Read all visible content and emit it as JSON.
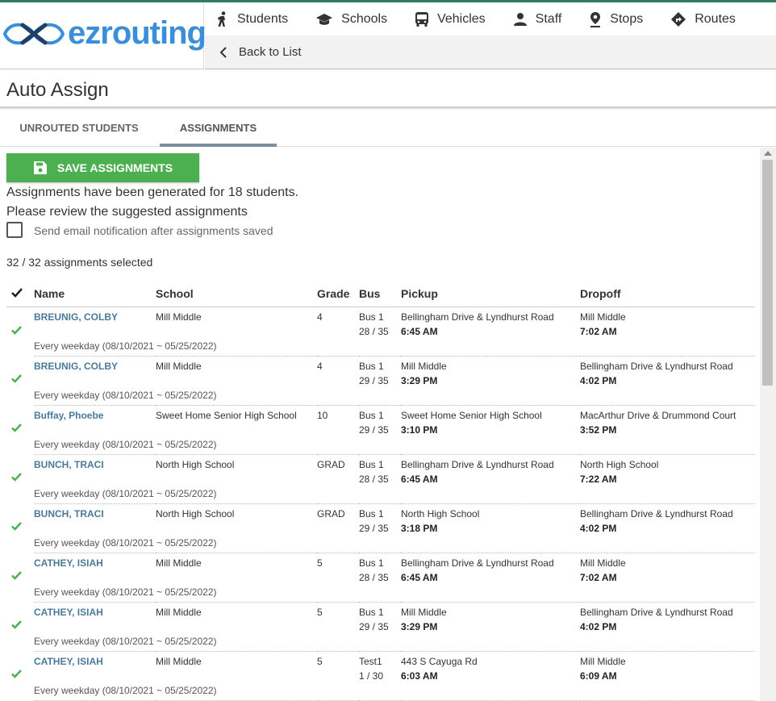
{
  "brand": {
    "name": "ezrouting"
  },
  "colors": {
    "accent": "#2e7d5b",
    "brand_blue": "#3a8fd8",
    "save_green": "#4caf50",
    "link": "#4a7a9a"
  },
  "nav": {
    "items": [
      {
        "label": "Students",
        "icon": "walking-person-icon"
      },
      {
        "label": "Schools",
        "icon": "graduation-cap-icon"
      },
      {
        "label": "Vehicles",
        "icon": "bus-icon"
      },
      {
        "label": "Staff",
        "icon": "person-icon"
      },
      {
        "label": "Stops",
        "icon": "map-pin-icon"
      },
      {
        "label": "Routes",
        "icon": "directions-icon"
      }
    ],
    "back_label": "Back to List"
  },
  "page": {
    "title": "Auto Assign"
  },
  "tabs": [
    {
      "label": "UNROUTED STUDENTS",
      "active": false
    },
    {
      "label": "ASSIGNMENTS",
      "active": true
    }
  ],
  "assignments": {
    "save_label": "SAVE ASSIGNMENTS",
    "message_line1": "Assignments have been generated for 18 students.",
    "message_line2": "Please review the suggested assignments",
    "email_checkbox_label": "Send email notification after assignments saved",
    "email_checked": false,
    "selected_count": "32 / 32 assignments selected"
  },
  "table": {
    "headers": {
      "name": "Name",
      "school": "School",
      "grade": "Grade",
      "bus": "Bus",
      "pickup": "Pickup",
      "dropoff": "Dropoff"
    },
    "rows": [
      {
        "name": "BREUNIG, COLBY",
        "school": "Mill Middle",
        "grade": "4",
        "bus": "Bus 1",
        "seats": "28 / 35",
        "pickup_place": "Bellingham Drive & Lyndhurst Road",
        "pickup_time": "6:45 AM",
        "dropoff_place": "Mill Middle",
        "dropoff_time": "7:02 AM",
        "schedule": "Every weekday (08/10/2021 ~ 05/25/2022)"
      },
      {
        "name": "BREUNIG, COLBY",
        "school": "Mill Middle",
        "grade": "4",
        "bus": "Bus 1",
        "seats": "29 / 35",
        "pickup_place": "Mill Middle",
        "pickup_time": "3:29 PM",
        "dropoff_place": "Bellingham Drive & Lyndhurst Road",
        "dropoff_time": "4:02 PM",
        "schedule": "Every weekday (08/10/2021 ~ 05/25/2022)"
      },
      {
        "name": "Buffay, Phoebe",
        "school": "Sweet Home Senior High School",
        "grade": "10",
        "bus": "Bus 1",
        "seats": "29 / 35",
        "pickup_place": "Sweet Home Senior High School",
        "pickup_time": "3:10 PM",
        "dropoff_place": "MacArthur Drive & Drummond Court",
        "dropoff_time": "3:52 PM",
        "schedule": "Every weekday (08/10/2021 ~ 05/25/2022)"
      },
      {
        "name": "BUNCH, TRACI",
        "school": "North High School",
        "grade": "GRAD",
        "bus": "Bus 1",
        "seats": "28 / 35",
        "pickup_place": "Bellingham Drive & Lyndhurst Road",
        "pickup_time": "6:45 AM",
        "dropoff_place": "North High School",
        "dropoff_time": "7:22 AM",
        "schedule": "Every weekday (08/10/2021 ~ 05/25/2022)"
      },
      {
        "name": "BUNCH, TRACI",
        "school": "North High School",
        "grade": "GRAD",
        "bus": "Bus 1",
        "seats": "29 / 35",
        "pickup_place": "North High School",
        "pickup_time": "3:18 PM",
        "dropoff_place": "Bellingham Drive & Lyndhurst Road",
        "dropoff_time": "4:02 PM",
        "schedule": "Every weekday (08/10/2021 ~ 05/25/2022)"
      },
      {
        "name": "CATHEY, ISIAH",
        "school": "Mill Middle",
        "grade": "5",
        "bus": "Bus 1",
        "seats": "28 / 35",
        "pickup_place": "Bellingham Drive & Lyndhurst Road",
        "pickup_time": "6:45 AM",
        "dropoff_place": "Mill Middle",
        "dropoff_time": "7:02 AM",
        "schedule": "Every weekday (08/10/2021 ~ 05/25/2022)"
      },
      {
        "name": "CATHEY, ISIAH",
        "school": "Mill Middle",
        "grade": "5",
        "bus": "Bus 1",
        "seats": "29 / 35",
        "pickup_place": "Mill Middle",
        "pickup_time": "3:29 PM",
        "dropoff_place": "Bellingham Drive & Lyndhurst Road",
        "dropoff_time": "4:02 PM",
        "schedule": "Every weekday (08/10/2021 ~ 05/25/2022)"
      },
      {
        "name": "CATHEY, ISIAH",
        "school": "Mill Middle",
        "grade": "5",
        "bus": "Test1",
        "seats": "1 / 30",
        "pickup_place": "443 S Cayuga Rd",
        "pickup_time": "6:03 AM",
        "dropoff_place": "Mill Middle",
        "dropoff_time": "6:09 AM",
        "schedule": "Every weekday (08/10/2021 ~ 05/25/2022)"
      }
    ]
  }
}
